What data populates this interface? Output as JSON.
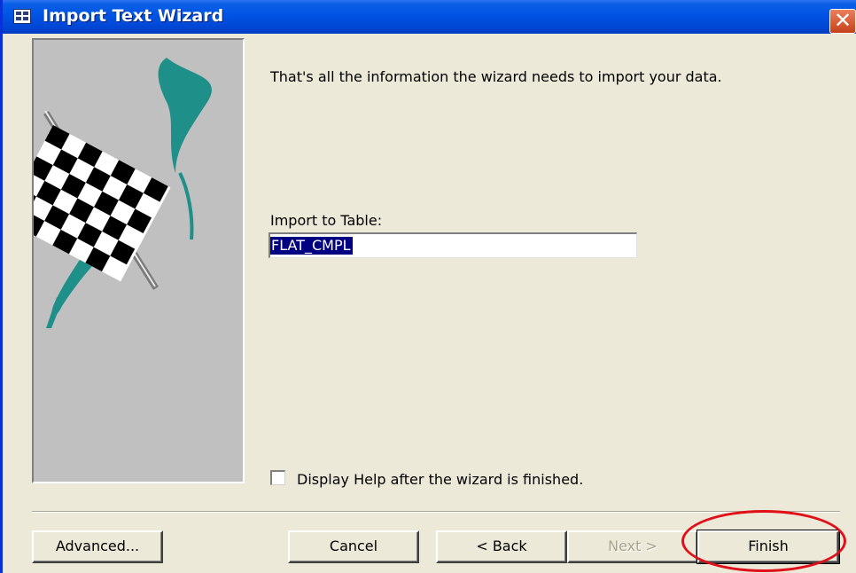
{
  "window": {
    "title": "Import Text Wizard",
    "title_icon": "table-icon",
    "close_symbol": "✕"
  },
  "content": {
    "message": "That's all the information the wizard needs to import your data.",
    "table_label": "Import to Table:",
    "table_value": "FLAT_CMPL",
    "help_checkbox_label": "Display Help after the wizard is finished.",
    "help_checkbox_checked": false
  },
  "buttons": {
    "advanced": "Advanced...",
    "cancel": "Cancel",
    "back": "< Back",
    "next": "Next >",
    "finish": "Finish"
  },
  "colors": {
    "titlebar": "#0054e3",
    "dialog_bg": "#ece9d8",
    "selection": "#000080",
    "flag_teal": "#1f8f8a",
    "annotation_ring": "#e0101a"
  }
}
